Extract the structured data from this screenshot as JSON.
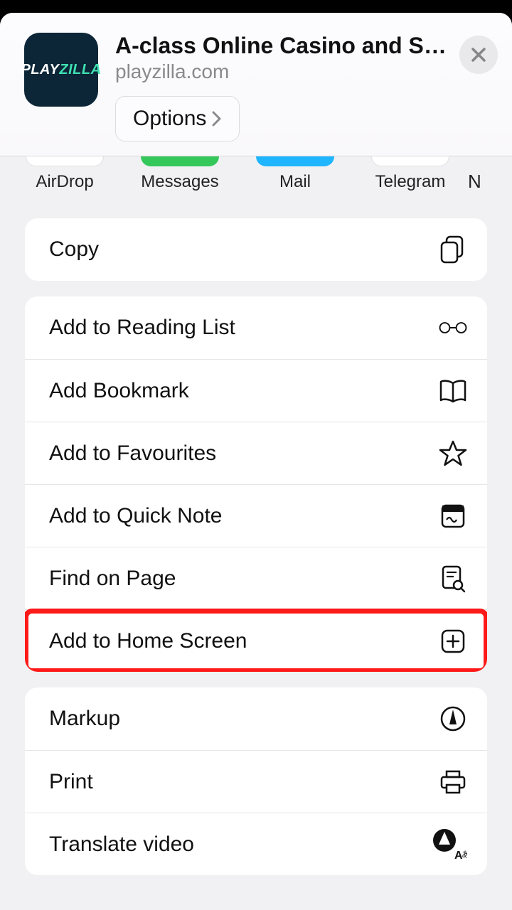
{
  "header": {
    "site_logo_part1": "PLAY",
    "site_logo_part2": "ZILLA",
    "title": "A-class Online Casino and Spor...",
    "subtitle": "playzilla.com",
    "options_label": "Options"
  },
  "share_targets": [
    {
      "label": "AirDrop"
    },
    {
      "label": "Messages"
    },
    {
      "label": "Mail"
    },
    {
      "label": "Telegram"
    }
  ],
  "share_overflow": "N",
  "section_copy": {
    "copy": "Copy"
  },
  "section_actions": {
    "reading_list": "Add to Reading List",
    "bookmark": "Add Bookmark",
    "favourites": "Add to Favourites",
    "quick_note": "Add to Quick Note",
    "find": "Find on Page",
    "home_screen": "Add to Home Screen"
  },
  "section_extra": {
    "markup": "Markup",
    "print": "Print",
    "translate": "Translate video"
  }
}
